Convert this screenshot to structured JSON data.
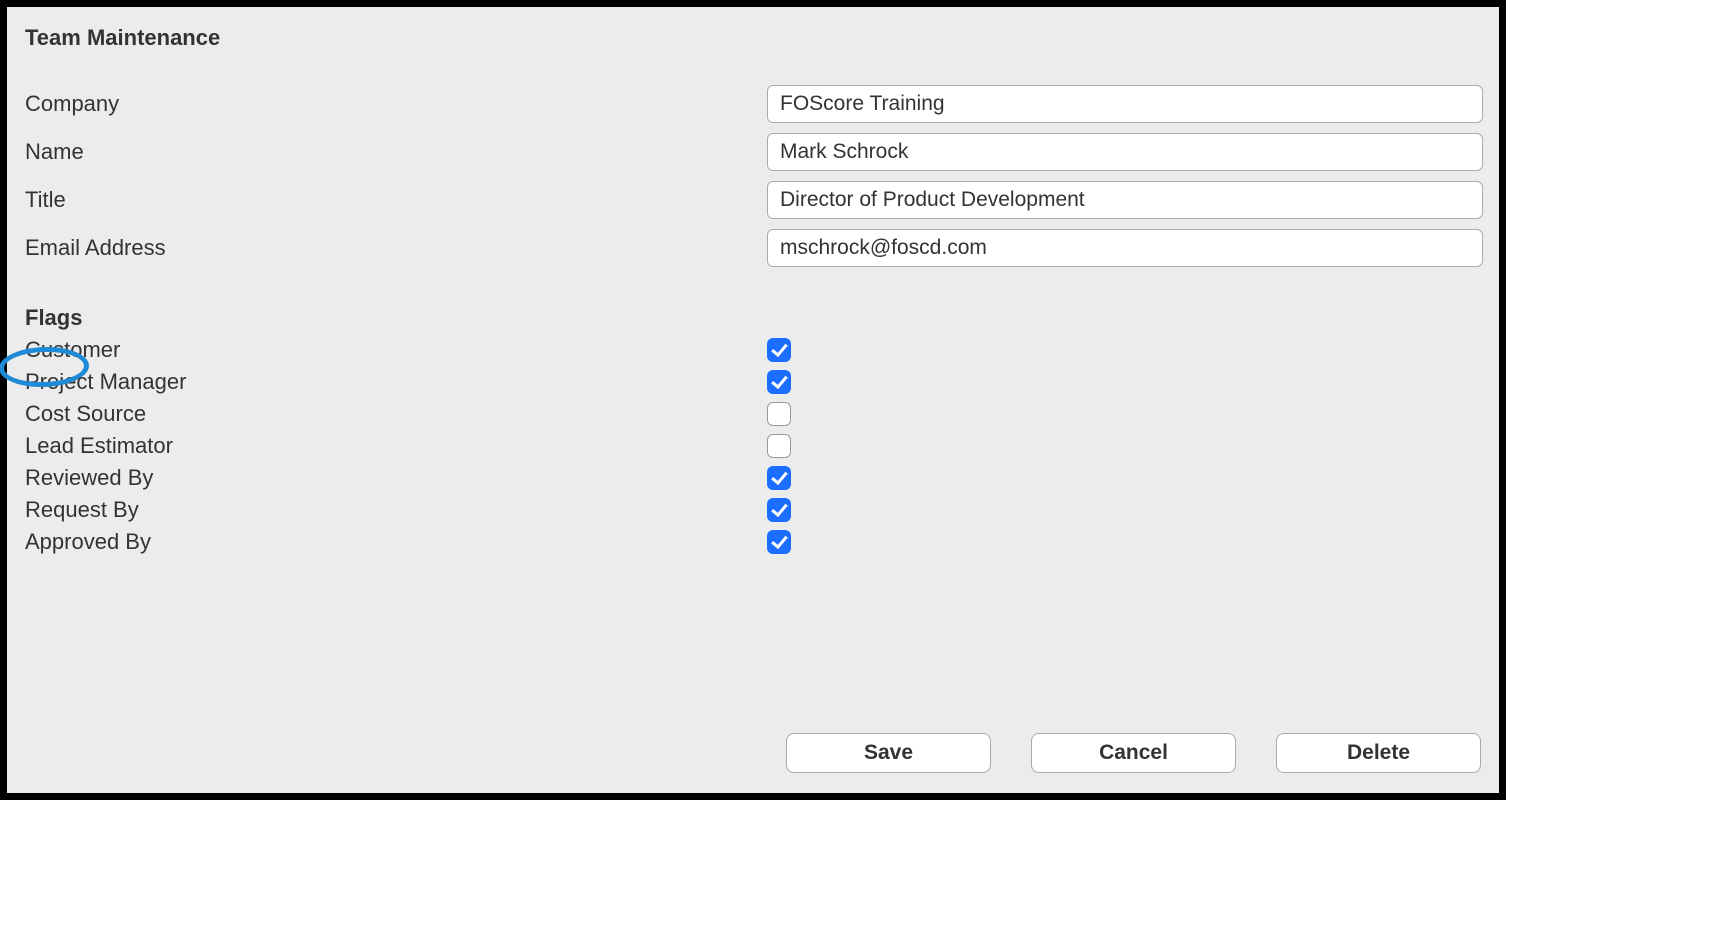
{
  "title": "Team Maintenance",
  "fields": {
    "company_label": "Company",
    "company_value": "FOScore Training",
    "name_label": "Name",
    "name_value": "Mark Schrock",
    "title_label": "Title",
    "title_value": "Director of Product Development",
    "email_label": "Email Address",
    "email_value": "mschrock@foscd.com"
  },
  "flags_section_label": "Flags",
  "flags": [
    {
      "label": "Customer",
      "checked": true
    },
    {
      "label": "Project Manager",
      "checked": true
    },
    {
      "label": "Cost Source",
      "checked": false
    },
    {
      "label": "Lead Estimator",
      "checked": false
    },
    {
      "label": "Reviewed By",
      "checked": true
    },
    {
      "label": "Request By",
      "checked": true
    },
    {
      "label": "Approved By",
      "checked": true
    }
  ],
  "buttons": {
    "save": "Save",
    "cancel": "Cancel",
    "delete": "Delete"
  }
}
